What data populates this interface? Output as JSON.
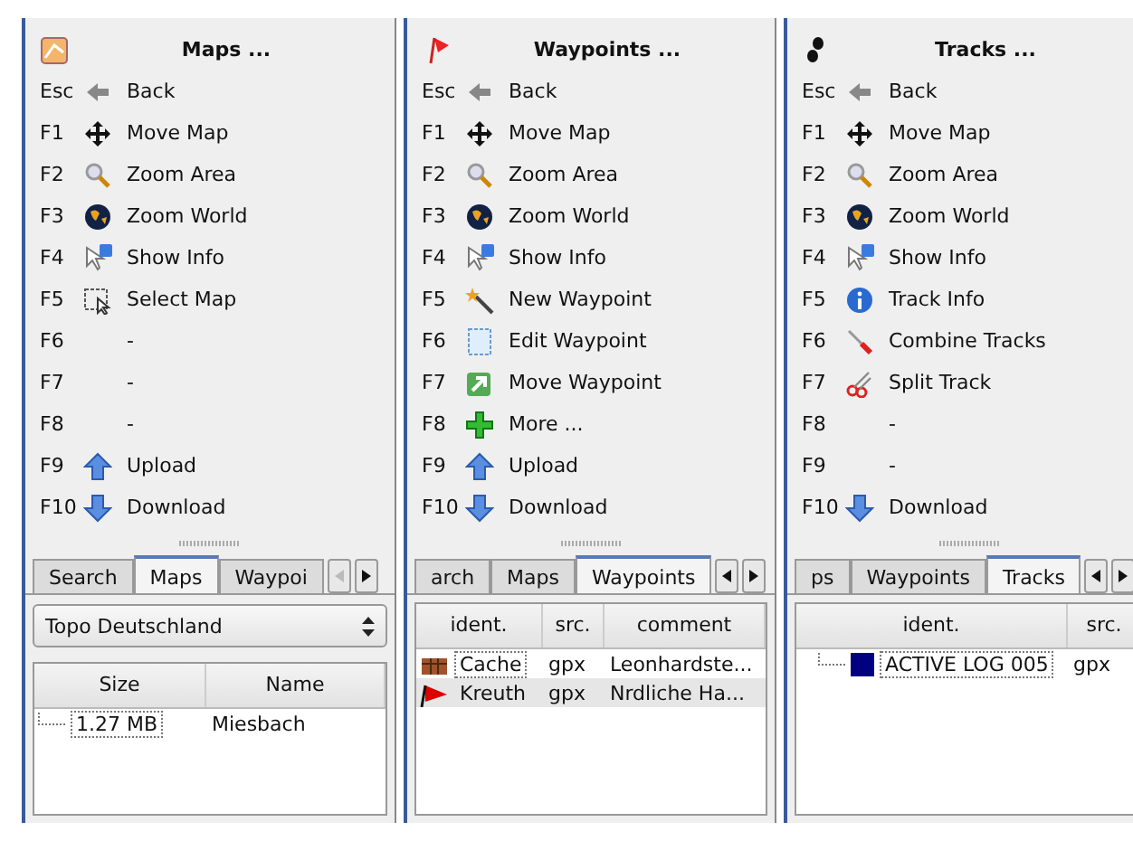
{
  "panels": [
    {
      "title": "Maps ...",
      "kind": "maps",
      "menu": [
        {
          "key": "Esc",
          "kind": "back",
          "label": "Back"
        },
        {
          "key": "F1",
          "kind": "move",
          "label": "Move Map"
        },
        {
          "key": "F2",
          "kind": "zoom",
          "label": "Zoom Area"
        },
        {
          "key": "F3",
          "kind": "globe",
          "label": "Zoom World"
        },
        {
          "key": "F4",
          "kind": "info-cursor",
          "label": "Show Info"
        },
        {
          "key": "F5",
          "kind": "select",
          "label": "Select Map"
        },
        {
          "key": "F6",
          "kind": "blank",
          "label": "-"
        },
        {
          "key": "F7",
          "kind": "blank",
          "label": "-"
        },
        {
          "key": "F8",
          "kind": "blank",
          "label": "-"
        },
        {
          "key": "F9",
          "kind": "upload",
          "label": "Upload"
        },
        {
          "key": "F10",
          "kind": "download",
          "label": "Download"
        }
      ],
      "tabs": [
        {
          "label": "Search",
          "selected": false
        },
        {
          "label": "Maps",
          "selected": true
        },
        {
          "label": "Waypoi",
          "selected": false
        }
      ],
      "dropdown": {
        "value": "Topo Deutschland"
      },
      "table": {
        "columns": [
          "Size",
          "Name"
        ],
        "rows": [
          {
            "cells": [
              "1.27 MB",
              "Miesbach"
            ],
            "selected": false
          }
        ]
      }
    },
    {
      "title": "Waypoints ...",
      "kind": "waypoints",
      "menu": [
        {
          "key": "Esc",
          "kind": "back",
          "label": "Back"
        },
        {
          "key": "F1",
          "kind": "move",
          "label": "Move Map"
        },
        {
          "key": "F2",
          "kind": "zoom",
          "label": "Zoom Area"
        },
        {
          "key": "F3",
          "kind": "globe",
          "label": "Zoom World"
        },
        {
          "key": "F4",
          "kind": "info-cursor",
          "label": "Show Info"
        },
        {
          "key": "F5",
          "kind": "wand",
          "label": "New Waypoint"
        },
        {
          "key": "F6",
          "kind": "edit",
          "label": "Edit Waypoint"
        },
        {
          "key": "F7",
          "kind": "move-waypoint",
          "label": "Move Waypoint"
        },
        {
          "key": "F8",
          "kind": "plus",
          "label": "More ..."
        },
        {
          "key": "F9",
          "kind": "upload",
          "label": "Upload"
        },
        {
          "key": "F10",
          "kind": "download",
          "label": "Download"
        }
      ],
      "tabs": [
        {
          "label": "arch",
          "selected": false
        },
        {
          "label": "Maps",
          "selected": false
        },
        {
          "label": "Waypoints",
          "selected": true
        }
      ],
      "table": {
        "columns": [
          "ident.",
          "src.",
          "comment"
        ],
        "rows": [
          {
            "kind": "chest",
            "cells": [
              "Cache",
              "gpx",
              "Leonhardste..."
            ],
            "selected": false
          },
          {
            "kind": "flag",
            "cells": [
              "Kreuth",
              "gpx",
              "Nrdliche Ha..."
            ],
            "selected": true
          }
        ]
      }
    },
    {
      "title": "Tracks ...",
      "kind": "tracks",
      "menu": [
        {
          "key": "Esc",
          "kind": "back",
          "label": "Back"
        },
        {
          "key": "F1",
          "kind": "move",
          "label": "Move Map"
        },
        {
          "key": "F2",
          "kind": "zoom",
          "label": "Zoom Area"
        },
        {
          "key": "F3",
          "kind": "globe",
          "label": "Zoom World"
        },
        {
          "key": "F4",
          "kind": "info-cursor",
          "label": "Show Info"
        },
        {
          "key": "F5",
          "kind": "info",
          "label": "Track Info"
        },
        {
          "key": "F6",
          "kind": "screwdriver",
          "label": "Combine Tracks"
        },
        {
          "key": "F7",
          "kind": "scissors",
          "label": "Split Track"
        },
        {
          "key": "F8",
          "kind": "blank",
          "label": "-"
        },
        {
          "key": "F9",
          "kind": "blank",
          "label": "-"
        },
        {
          "key": "F10",
          "kind": "download",
          "label": "Download"
        }
      ],
      "tabs": [
        {
          "label": "ps",
          "selected": false
        },
        {
          "label": "Waypoints",
          "selected": false
        },
        {
          "label": "Tracks",
          "selected": true
        }
      ],
      "table": {
        "columns": [
          "ident.",
          "src."
        ],
        "rows": [
          {
            "color": "#000080",
            "cells": [
              "ACTIVE LOG 005",
              "gpx"
            ],
            "selected": false
          }
        ]
      }
    }
  ]
}
